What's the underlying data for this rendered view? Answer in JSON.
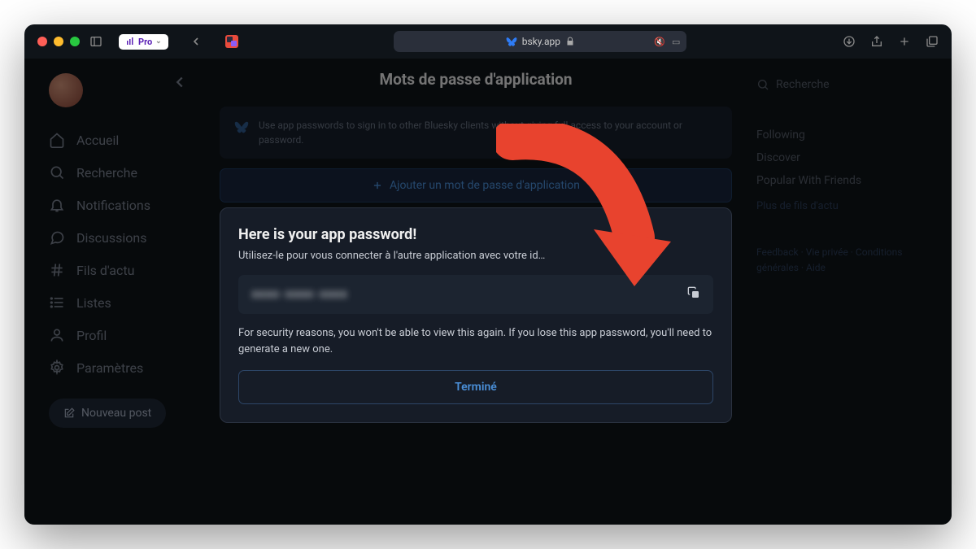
{
  "titlebar": {
    "pro_label": "Pro",
    "address": "bsky.app"
  },
  "sidebar": {
    "items": [
      {
        "label": "Accueil"
      },
      {
        "label": "Recherche"
      },
      {
        "label": "Notifications"
      },
      {
        "label": "Discussions"
      },
      {
        "label": "Fils d'actu"
      },
      {
        "label": "Listes"
      },
      {
        "label": "Profil"
      },
      {
        "label": "Paramètres"
      }
    ],
    "new_post": "Nouveau post"
  },
  "main": {
    "title": "Mots de passe d'application",
    "banner": "Use app passwords to sign in to other Bluesky clients without giving full access to your account or password.",
    "add_button": "Ajouter un mot de passe d'application"
  },
  "dialog": {
    "title": "Here is your app password!",
    "subtitle": "Utilisez-le pour vous connecter à l'autre application avec votre id…",
    "password_masked": "xxxx-xxxx-xxxx",
    "warning": "For security reasons, you won't be able to view this again. If you lose this app password, you'll need to generate a new one.",
    "done": "Terminé"
  },
  "right": {
    "search_placeholder": "Recherche",
    "feeds": [
      "Following",
      "Discover",
      "Popular With Friends"
    ],
    "more_feeds": "Plus de fils d'actu",
    "footer": [
      "Feedback",
      "Vie privée",
      "Conditions générales",
      "Aide"
    ]
  }
}
